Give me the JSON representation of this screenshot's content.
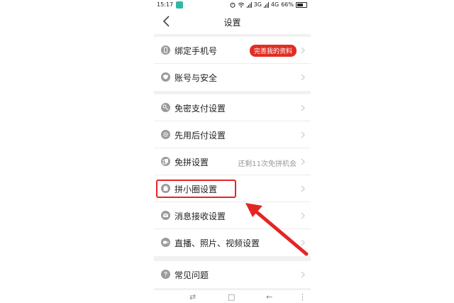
{
  "status_bar": {
    "time": "15:17",
    "network_1": "3G",
    "network_2": "4G",
    "battery": "66%",
    "app_icon": "app-notification-icon",
    "alarm_icon": "alarm-icon",
    "wifi_icon": "wifi-icon"
  },
  "header": {
    "title": "设置",
    "back_icon": "back-chevron-icon"
  },
  "groups": [
    {
      "items": [
        {
          "label": "绑定手机号",
          "badge": "完善我的资料",
          "icon": "phone-icon"
        },
        {
          "label": "账号与安全",
          "icon": "shield-icon"
        }
      ]
    },
    {
      "items": [
        {
          "label": "免密支付设置",
          "icon": "key-icon"
        },
        {
          "label": "先用后付设置",
          "icon": "gear-icon"
        },
        {
          "label": "免拼设置",
          "hint": "还剩11次免拼机会",
          "icon": "copy-icon"
        },
        {
          "label": "拼小圈设置",
          "icon": "bag-icon"
        },
        {
          "label": "消息接收设置",
          "icon": "message-icon"
        },
        {
          "label": "直播、照片、视频设置",
          "icon": "video-icon"
        }
      ]
    },
    {
      "items": [
        {
          "label": "常见问题",
          "icon": "question-icon"
        }
      ]
    }
  ],
  "nav_bar": {
    "menu_glyph": "⇄",
    "home_glyph": "□",
    "back_glyph": "←",
    "more_glyph": "⋮"
  },
  "annotation": {
    "highlight_color": "#e42525",
    "arrow_color": "#e42525"
  },
  "colors": {
    "badge_bg": "#e02e24",
    "icon_gray": "#9b9b9b",
    "page_bg": "#f1f1f1"
  }
}
